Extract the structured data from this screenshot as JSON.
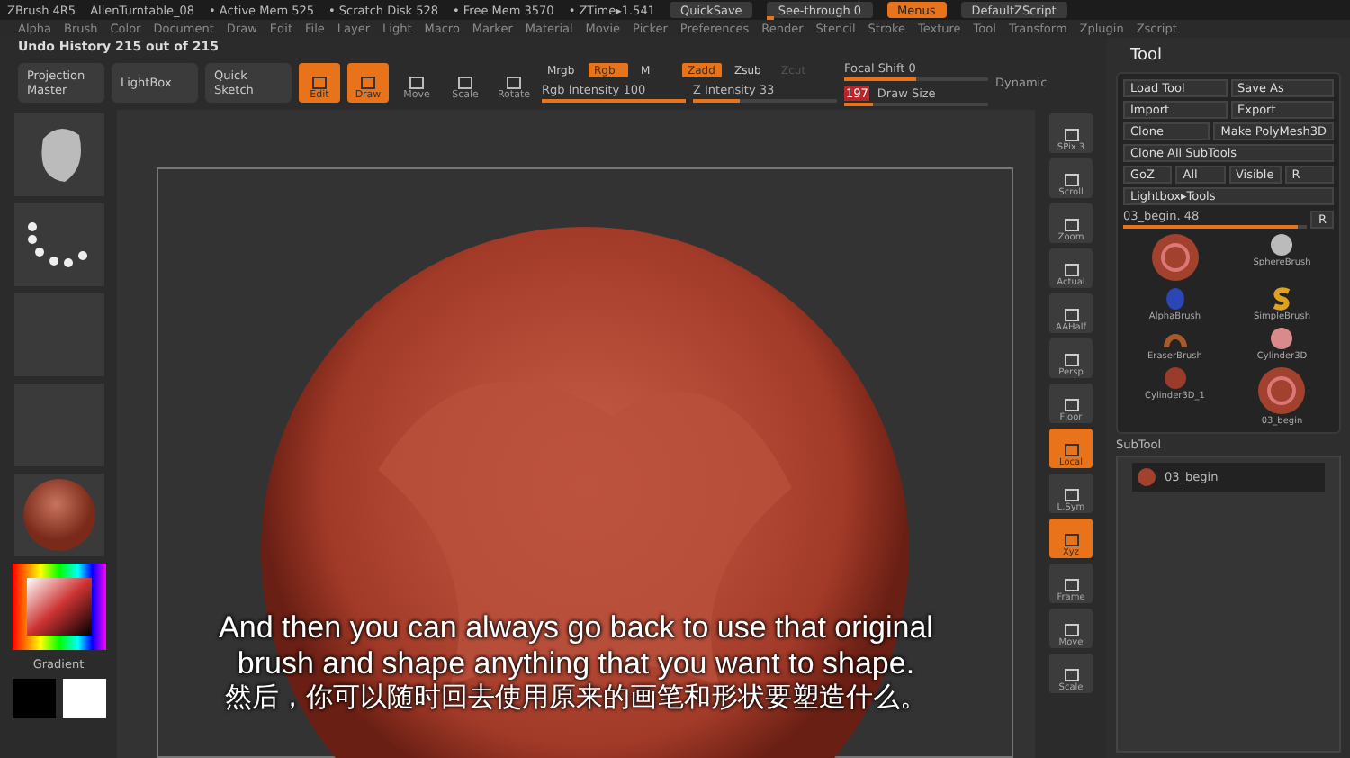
{
  "title_bar": {
    "app": "ZBrush 4R5",
    "file": "AllenTurntable_08",
    "stats": [
      "• Active Mem 525",
      "• Scratch Disk 528",
      "• Free Mem 3570",
      "• ZTime▸1.541"
    ],
    "buttons": [
      {
        "label": "QuickSave",
        "kind": "button",
        "selected": false
      },
      {
        "label": "See-through 0",
        "kind": "slider",
        "level": 0.05
      },
      {
        "label": "Menus",
        "kind": "toggle",
        "selected": true
      },
      {
        "label": "DefaultZScript",
        "kind": "button",
        "selected": false
      }
    ]
  },
  "menu": [
    "Alpha",
    "Brush",
    "Color",
    "Document",
    "Draw",
    "Edit",
    "File",
    "Layer",
    "Light",
    "Macro",
    "Marker",
    "Material",
    "Movie",
    "Picker",
    "Preferences",
    "Render",
    "Stencil",
    "Stroke",
    "Texture",
    "Tool",
    "Transform",
    "Zplugin",
    "Zscript"
  ],
  "undo_history": "Undo History 215 out of 215",
  "toolbar": {
    "big_buttons": [
      {
        "label": "Projection Master"
      },
      {
        "label": "LightBox"
      },
      {
        "label": "Quick Sketch"
      }
    ],
    "modes": [
      {
        "label": "Edit",
        "selected": true
      },
      {
        "label": "Draw",
        "selected": true
      },
      {
        "label": "Move",
        "selected": false
      },
      {
        "label": "Scale",
        "selected": false
      },
      {
        "label": "Rotate",
        "selected": false
      }
    ],
    "color_modes": [
      {
        "label": "Mrgb",
        "selected": false
      },
      {
        "label": "Rgb",
        "selected": true
      },
      {
        "label": "M",
        "selected": false
      }
    ],
    "z_modes": [
      {
        "label": "Zadd",
        "selected": true,
        "disabled": false
      },
      {
        "label": "Zsub",
        "selected": false,
        "disabled": false
      },
      {
        "label": "Zcut",
        "selected": false,
        "disabled": true
      }
    ],
    "sliders": [
      {
        "label": "Rgb Intensity 100",
        "level": 1
      },
      {
        "label": "Z Intensity 33",
        "level": 0.33
      },
      {
        "label": "Focal Shift 0",
        "level": 0.5
      },
      {
        "value": "197",
        "label": "Draw Size",
        "level": 0.2
      }
    ],
    "dynamic": "Dynamic"
  },
  "right_shelf": [
    {
      "label": "SPix 3",
      "selected": false
    },
    {
      "label": "Scroll",
      "selected": false
    },
    {
      "label": "Zoom",
      "selected": false
    },
    {
      "label": "Actual",
      "selected": false
    },
    {
      "label": "AAHalf",
      "selected": false
    },
    {
      "label": "Persp",
      "selected": false
    },
    {
      "label": "Floor",
      "selected": false
    },
    {
      "label": "Local",
      "selected": true
    },
    {
      "label": "L.Sym",
      "selected": false
    },
    {
      "label": "Xyz",
      "selected": true
    },
    {
      "label": "Frame",
      "selected": false
    },
    {
      "label": "Move",
      "selected": false
    },
    {
      "label": "Scale",
      "selected": false
    }
  ],
  "left_shelf": {
    "gradient": "Gradient"
  },
  "tool_panel": {
    "title": "Tool",
    "buttons": [
      [
        "Load Tool",
        "Save As"
      ],
      [
        "Import",
        "Export"
      ],
      [
        "Clone",
        "Make PolyMesh3D"
      ],
      [
        "Clone All SubTools"
      ],
      [
        "GoZ",
        "All",
        "Visible",
        "R"
      ],
      [
        "Lightbox▸Tools"
      ]
    ],
    "tool_slider": {
      "label": "03_begin. 48",
      "level": 0.95,
      "reset": "R"
    },
    "thumbnails": [
      {
        "kind": "current"
      },
      {
        "label": "SphereBrush",
        "kind": "sphere"
      },
      {
        "label": "AlphaBrush",
        "kind": "gem"
      },
      {
        "label": "SimpleBrush",
        "kind": "letter"
      },
      {
        "label": "EraserBrush",
        "kind": "ring"
      },
      {
        "label": "Cylinder3D",
        "kind": "disc"
      },
      {
        "label": "Cylinder3D_1",
        "kind": "ball"
      },
      {
        "label": "03_begin",
        "kind": "current"
      }
    ],
    "subtool": {
      "title": "SubTool",
      "item": "03_begin"
    }
  },
  "subtitles": [
    "And then you can always go back to use that original",
    "brush and shape anything that you want to shape.",
    "然后，你可以随时回去使用原来的画笔和形状要塑造什么。"
  ]
}
